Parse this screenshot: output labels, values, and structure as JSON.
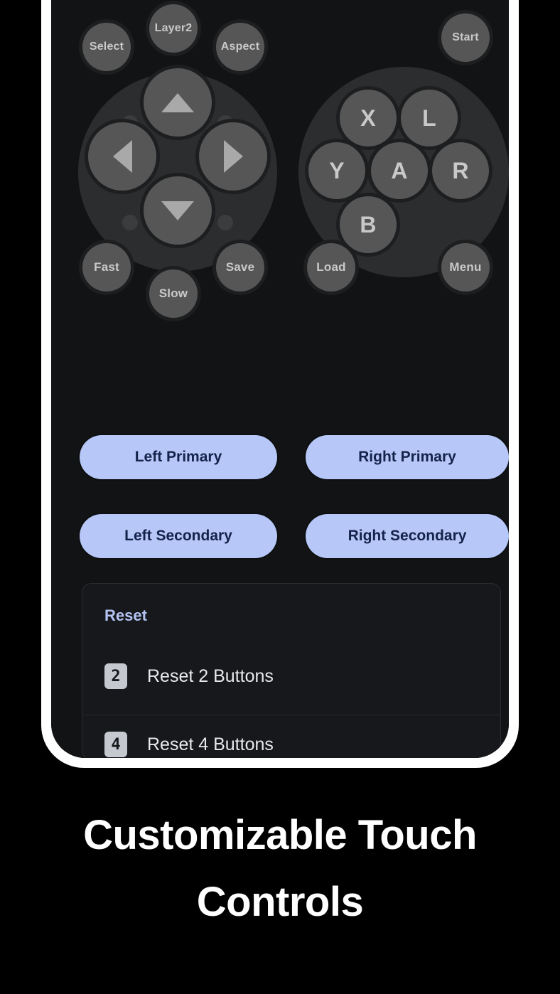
{
  "caption": {
    "line1": "Customizable Touch",
    "line2": "Controls"
  },
  "colors": {
    "background": "#000000",
    "phone_frame": "#ffffff",
    "screen": "#111315",
    "pad_button": "#565656",
    "pad_base": "#2b2d2f",
    "pad_glyph": "#a9a9a9",
    "pill_bg": "#b6c7f8",
    "pill_text": "#14234a",
    "reset_title": "#b4c3f2",
    "reset_label": "#e7e9ec",
    "num_chip_bg": "#c5c8cf"
  },
  "touch_controls": {
    "left_top_buttons": [
      {
        "label": "Select",
        "name": "select-button"
      },
      {
        "label": "Layer2",
        "name": "layer2-button"
      },
      {
        "label": "Aspect",
        "name": "aspect-button"
      }
    ],
    "right_top_buttons": [
      {
        "label": "Start",
        "name": "start-button"
      }
    ],
    "dpad": [
      {
        "label": "",
        "icon": "triangle-up-icon",
        "name": "dpad-up-button"
      },
      {
        "label": "",
        "icon": "triangle-left-icon",
        "name": "dpad-left-button"
      },
      {
        "label": "",
        "icon": "triangle-right-icon",
        "name": "dpad-right-button"
      },
      {
        "label": "",
        "icon": "triangle-down-icon",
        "name": "dpad-down-button"
      }
    ],
    "action_buttons": [
      {
        "label": "X",
        "name": "action-button-x"
      },
      {
        "label": "L",
        "name": "action-button-l"
      },
      {
        "label": "Y",
        "name": "action-button-y"
      },
      {
        "label": "A",
        "name": "action-button-a"
      },
      {
        "label": "R",
        "name": "action-button-r"
      },
      {
        "label": "B",
        "name": "action-button-b"
      }
    ],
    "left_bottom_buttons": [
      {
        "label": "Fast",
        "name": "fast-button"
      },
      {
        "label": "Slow",
        "name": "slow-button"
      },
      {
        "label": "Save",
        "name": "save-button"
      }
    ],
    "right_bottom_buttons": [
      {
        "label": "Load",
        "name": "load-button"
      },
      {
        "label": "Menu",
        "name": "menu-button"
      }
    ]
  },
  "pills": [
    {
      "label": "Left Primary",
      "name": "left-primary-button"
    },
    {
      "label": "Right Primary",
      "name": "right-primary-button"
    },
    {
      "label": "Left Secondary",
      "name": "left-secondary-button"
    },
    {
      "label": "Right Secondary",
      "name": "right-secondary-button"
    }
  ],
  "reset": {
    "title": "Reset",
    "items": [
      {
        "chip": "2",
        "label": "Reset 2 Buttons"
      },
      {
        "chip": "4",
        "label": "Reset 4 Buttons"
      }
    ]
  }
}
